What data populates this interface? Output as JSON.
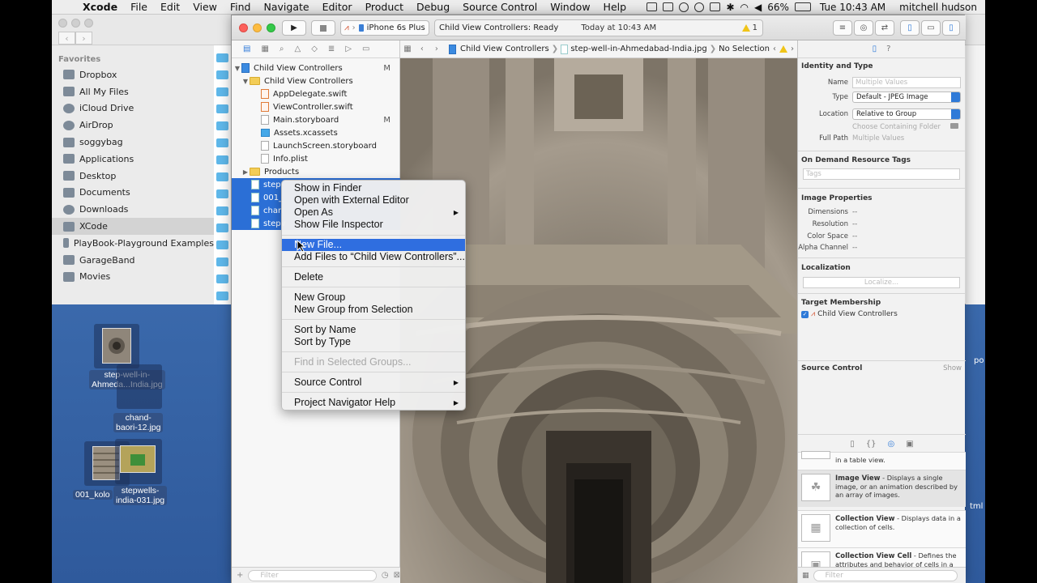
{
  "menubar": {
    "items": [
      "Xcode",
      "File",
      "Edit",
      "View",
      "Find",
      "Navigate",
      "Editor",
      "Product",
      "Debug",
      "Source Control",
      "Window",
      "Help"
    ],
    "battery": "66%",
    "clock": "Tue 10:43 AM",
    "user": "mitchell hudson"
  },
  "finder": {
    "section": "Favorites",
    "items": [
      "Dropbox",
      "All My Files",
      "iCloud Drive",
      "AirDrop",
      "soggybag",
      "Applications",
      "Desktop",
      "Documents",
      "Downloads",
      "XCode",
      "PlayBook-Playground Examples",
      "GarageBand",
      "Movies"
    ],
    "selected": "XCode"
  },
  "xcode": {
    "scheme_device": "iPhone 6s Plus",
    "activity_status": "Child View Controllers: Ready",
    "activity_time": "Today at 10:43 AM",
    "warning_count": "1",
    "navigator": {
      "rows": [
        {
          "label": "Child View Controllers",
          "badge": "M"
        },
        {
          "label": "Child View Controllers",
          "badge": ""
        },
        {
          "label": "AppDelegate.swift",
          "badge": ""
        },
        {
          "label": "ViewController.swift",
          "badge": ""
        },
        {
          "label": "Main.storyboard",
          "badge": "M"
        },
        {
          "label": "Assets.xcassets",
          "badge": ""
        },
        {
          "label": "LaunchScreen.storyboard",
          "badge": ""
        },
        {
          "label": "Info.plist",
          "badge": ""
        },
        {
          "label": "Products",
          "badge": ""
        },
        {
          "label": "step-",
          "badge": ""
        },
        {
          "label": "001_",
          "badge": ""
        },
        {
          "label": "chan",
          "badge": ""
        },
        {
          "label": "stepv",
          "badge": ""
        }
      ],
      "filter_placeholder": "Filter"
    },
    "jumpbar": {
      "project": "Child View Controllers",
      "file": "step-well-in-Ahmedabad-India.jpg",
      "selection": "No Selection"
    },
    "inspector": {
      "identity_title": "Identity and Type",
      "name_label": "Name",
      "name_placeholder": "Multiple Values",
      "type_label": "Type",
      "type_value": "Default - JPEG Image",
      "location_label": "Location",
      "location_value": "Relative to Group",
      "choose_folder": "Choose Containing Folder",
      "fullpath_label": "Full Path",
      "fullpath_value": "Multiple Values",
      "odr_title": "On Demand Resource Tags",
      "tags_placeholder": "Tags",
      "image_props_title": "Image Properties",
      "dimensions_label": "Dimensions",
      "resolution_label": "Resolution",
      "colorspace_label": "Color Space",
      "alpha_label": "Alpha Channel",
      "dash": "--",
      "localization_title": "Localization",
      "localize_button": "Localize...",
      "target_title": "Target Membership",
      "target_name": "Child View Controllers",
      "source_control_title": "Source Control",
      "show_label": "Show"
    },
    "library": [
      {
        "title": "",
        "desc": "in a table view."
      },
      {
        "title": "Image View",
        "desc": " - Displays a single image, or an animation described by an array of images."
      },
      {
        "title": "Collection View",
        "desc": " - Displays data in a collection of cells."
      },
      {
        "title": "Collection View Cell",
        "desc": " - Defines the attributes and behavior of cells in a"
      }
    ],
    "library_filter_placeholder": "Filter"
  },
  "context_menu": {
    "items": [
      {
        "label": "Show in Finder",
        "state": "normal",
        "submenu": false
      },
      {
        "label": "Open with External Editor",
        "state": "normal",
        "submenu": false
      },
      {
        "label": "Open As",
        "state": "normal",
        "submenu": true
      },
      {
        "label": "Show File Inspector",
        "state": "normal",
        "submenu": false
      },
      {
        "label": "New File...",
        "state": "highlighted",
        "submenu": false
      },
      {
        "label": "Add Files to “Child View Controllers”...",
        "state": "normal",
        "submenu": false
      },
      {
        "label": "Delete",
        "state": "normal",
        "submenu": false
      },
      {
        "label": "New Group",
        "state": "normal",
        "submenu": false
      },
      {
        "label": "New Group from Selection",
        "state": "normal",
        "submenu": false
      },
      {
        "label": "Sort by Name",
        "state": "normal",
        "submenu": false
      },
      {
        "label": "Sort by Type",
        "state": "normal",
        "submenu": false
      },
      {
        "label": "Find in Selected Groups...",
        "state": "disabled",
        "submenu": false
      },
      {
        "label": "Source Control",
        "state": "normal",
        "submenu": true
      },
      {
        "label": "Project Navigator Help",
        "state": "normal",
        "submenu": true
      }
    ]
  },
  "desktop": {
    "icons": [
      {
        "line1": "step-well-in-",
        "line2": "Ahmeda...India.jpg"
      },
      {
        "line1": "chand-",
        "line2": "baori-12.jpg"
      },
      {
        "line1": "001_kolo",
        "line2": ""
      },
      {
        "line1": "stepwells-",
        "line2": "india-031.jpg"
      }
    ],
    "edge_texts": [
      "po",
      "tml"
    ]
  },
  "colors": {
    "accent": "#2f6ee0",
    "selection": "#2b6fd6",
    "desktop": "#3a6fb5",
    "close": "#fc605b",
    "minimize": "#fdbc40",
    "zoom": "#34c84a"
  }
}
